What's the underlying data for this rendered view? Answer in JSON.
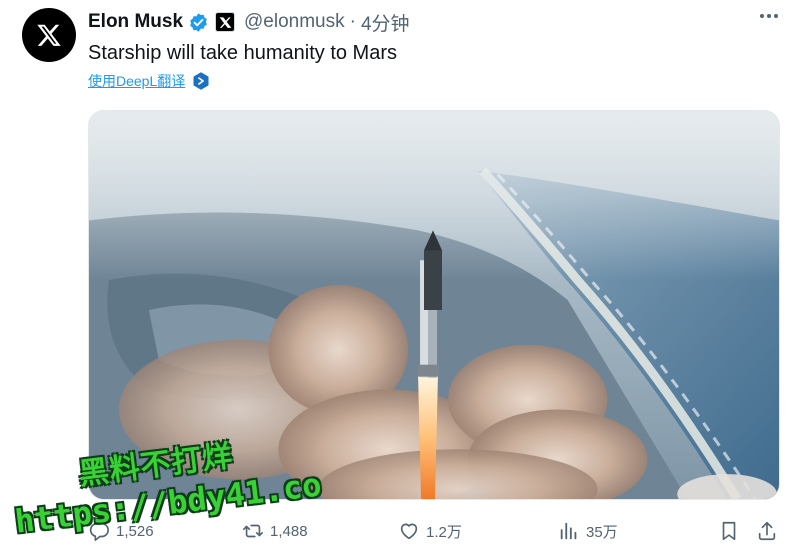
{
  "author": {
    "name": "Elon Musk",
    "handle": "@elonmusk",
    "separator": "·",
    "time": "4分钟",
    "avatar_icon": "x-logo-icon",
    "verified_icon": "verified-badge-icon",
    "affiliation_icon": "x-affiliate-badge-icon"
  },
  "tweet": {
    "text": "Starship will take humanity to Mars",
    "translate_label": "使用DeepL翻译",
    "translate_icon": "deepl-icon",
    "media_alt": "photo"
  },
  "actions": {
    "reply": {
      "icon": "reply-icon",
      "count": "1,526"
    },
    "retweet": {
      "icon": "retweet-icon",
      "count": "1,488"
    },
    "like": {
      "icon": "heart-icon",
      "count": "1.2万"
    },
    "views": {
      "icon": "views-chart-icon",
      "count": "35万"
    },
    "bookmark": {
      "icon": "bookmark-icon"
    },
    "share": {
      "icon": "share-icon"
    }
  },
  "watermark": {
    "line1": "黑料不打烊",
    "line2": "https://bdy41.co"
  },
  "colors": {
    "text": "#0f1419",
    "muted": "#536471",
    "link": "#1d9bf0",
    "verified": "#1d9bf0",
    "watermark": "#3ad136"
  }
}
